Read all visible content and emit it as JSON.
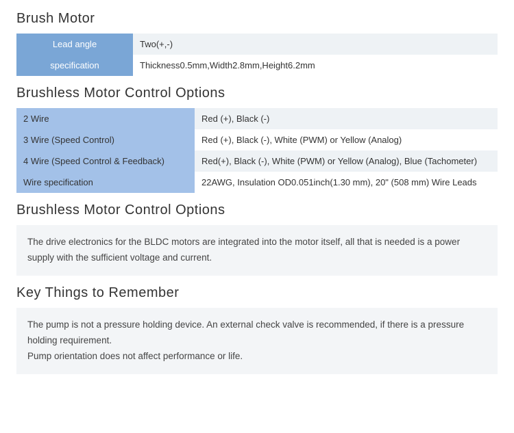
{
  "section1": {
    "title": "Brush Motor",
    "rows": [
      {
        "label": "Lead angle",
        "value": "Two(+,-)"
      },
      {
        "label": "specification",
        "value": "Thickness0.5mm,Width2.8mm,Height6.2mm"
      }
    ]
  },
  "section2": {
    "title": "Brushless Motor Control Options",
    "rows": [
      {
        "label": "2 Wire",
        "value": "Red (+), Black (-)"
      },
      {
        "label": "3 Wire (Speed Control)",
        "value": "Red (+), Black (-), White (PWM) or Yellow (Analog)"
      },
      {
        "label": "4 Wire (Speed Control & Feedback)",
        "value": "Red(+), Black (-), White (PWM) or Yellow (Analog), Blue (Tachometer)"
      },
      {
        "label": "Wire specification",
        "value": "22AWG, Insulation OD0.051inch(1.30 mm), 20\" (508 mm) Wire Leads"
      }
    ]
  },
  "section3": {
    "title": "Brushless Motor Control Options",
    "text": "The drive electronics for the BLDC motors are integrated into the motor itself, all that is needed is a power supply with the sufficient voltage and current."
  },
  "section4": {
    "title": "Key Things to Remember",
    "text1": "The pump is not a pressure holding device. An external check valve is recommended, if there is a pressure holding requirement.",
    "text2": "Pump orientation does not affect performance or life."
  }
}
